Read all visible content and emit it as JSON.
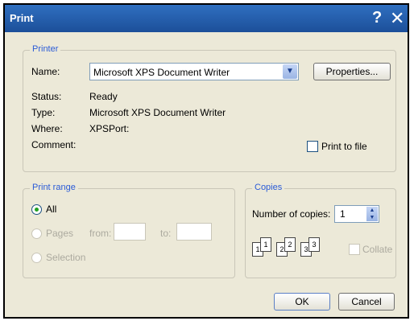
{
  "window": {
    "title": "Print"
  },
  "printer": {
    "legend": "Printer",
    "name_label": "Name:",
    "name_value": "Microsoft XPS Document Writer",
    "properties_label": "Properties...",
    "status_label": "Status:",
    "status_value": "Ready",
    "type_label": "Type:",
    "type_value": "Microsoft XPS Document Writer",
    "where_label": "Where:",
    "where_value": "XPSPort:",
    "comment_label": "Comment:",
    "print_to_file_label": "Print to file"
  },
  "print_range": {
    "legend": "Print range",
    "all_label": "All",
    "pages_label": "Pages",
    "from_label": "from:",
    "to_label": "to:",
    "selection_label": "Selection"
  },
  "copies": {
    "legend": "Copies",
    "number_label": "Number of copies:",
    "number_value": "1",
    "collate_label": "Collate",
    "pages": [
      "1",
      "1",
      "2",
      "2",
      "3",
      "3"
    ]
  },
  "buttons": {
    "ok": "OK",
    "cancel": "Cancel"
  },
  "icons": {
    "help": "?",
    "close": "✕"
  }
}
